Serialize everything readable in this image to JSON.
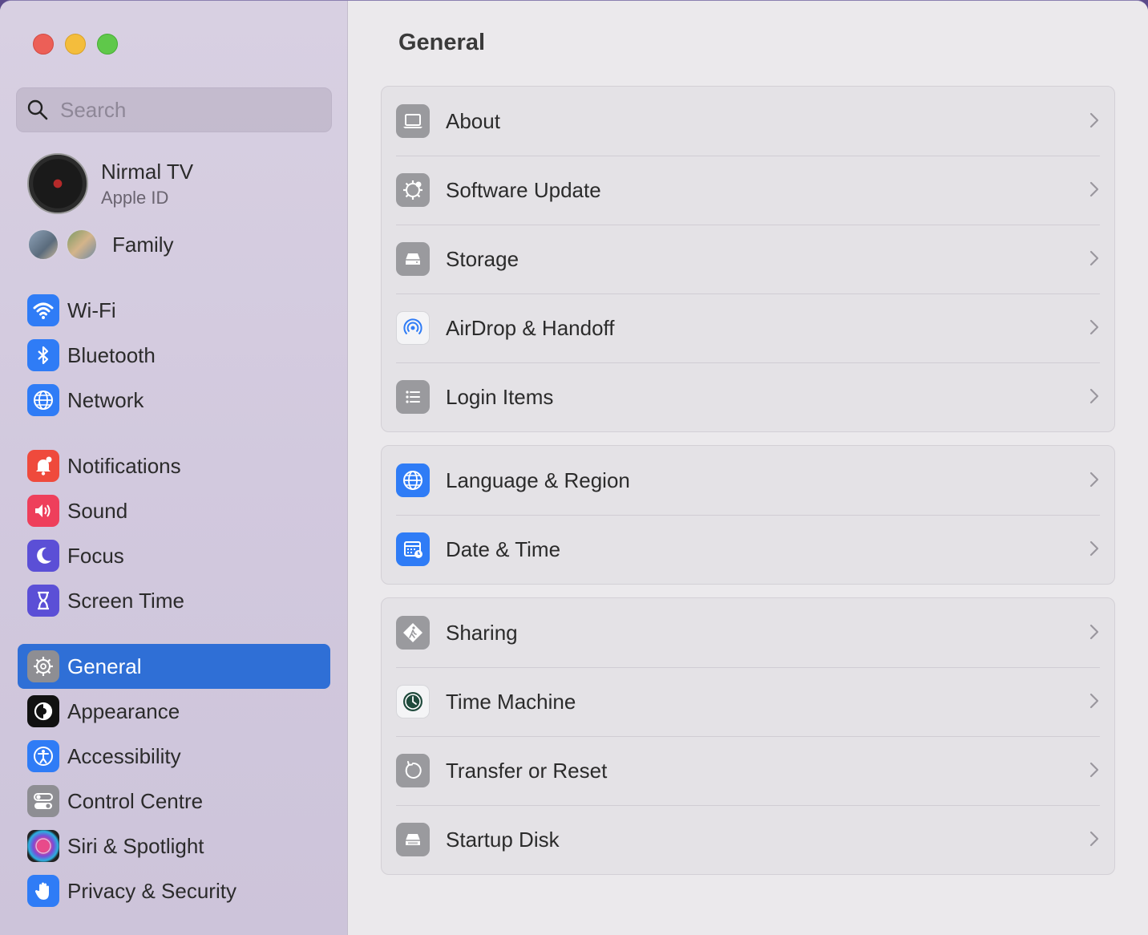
{
  "search": {
    "placeholder": "Search"
  },
  "account": {
    "name": "Nirmal TV",
    "subtitle": "Apple ID"
  },
  "family": {
    "label": "Family"
  },
  "sidebar": {
    "items": [
      {
        "label": "Wi-Fi",
        "icon": "wifi-icon",
        "color": "#2f7cf6"
      },
      {
        "label": "Bluetooth",
        "icon": "bluetooth-icon",
        "color": "#2f7cf6"
      },
      {
        "label": "Network",
        "icon": "globe-icon",
        "color": "#2f7cf6"
      },
      {
        "label": "Notifications",
        "icon": "bell-icon",
        "color": "#ef4a3c"
      },
      {
        "label": "Sound",
        "icon": "speaker-icon",
        "color": "#ee3f5b"
      },
      {
        "label": "Focus",
        "icon": "moon-icon",
        "color": "#5b4fd6"
      },
      {
        "label": "Screen Time",
        "icon": "hourglass-icon",
        "color": "#5b4fd6"
      },
      {
        "label": "General",
        "icon": "gear-icon",
        "color": "#8e8e93",
        "active": true
      },
      {
        "label": "Appearance",
        "icon": "appearance-icon",
        "color": "#111111"
      },
      {
        "label": "Accessibility",
        "icon": "accessibility-icon",
        "color": "#2f7cf6"
      },
      {
        "label": "Control Centre",
        "icon": "toggles-icon",
        "color": "#8e8e93"
      },
      {
        "label": "Siri & Spotlight",
        "icon": "siri-icon",
        "color": "#222222"
      },
      {
        "label": "Privacy & Security",
        "icon": "hand-icon",
        "color": "#2f7cf6"
      }
    ]
  },
  "main": {
    "title": "General",
    "groups": [
      [
        {
          "label": "About",
          "icon": "laptop-icon"
        },
        {
          "label": "Software Update",
          "icon": "gear-badge-icon"
        },
        {
          "label": "Storage",
          "icon": "drive-icon"
        },
        {
          "label": "AirDrop & Handoff",
          "icon": "airdrop-icon"
        },
        {
          "label": "Login Items",
          "icon": "list-icon"
        }
      ],
      [
        {
          "label": "Language & Region",
          "icon": "globe-icon"
        },
        {
          "label": "Date & Time",
          "icon": "calendar-clock-icon"
        }
      ],
      [
        {
          "label": "Sharing",
          "icon": "sharing-icon"
        },
        {
          "label": "Time Machine",
          "icon": "time-machine-icon"
        },
        {
          "label": "Transfer or Reset",
          "icon": "reset-icon"
        },
        {
          "label": "Startup Disk",
          "icon": "startup-disk-icon"
        }
      ]
    ]
  }
}
